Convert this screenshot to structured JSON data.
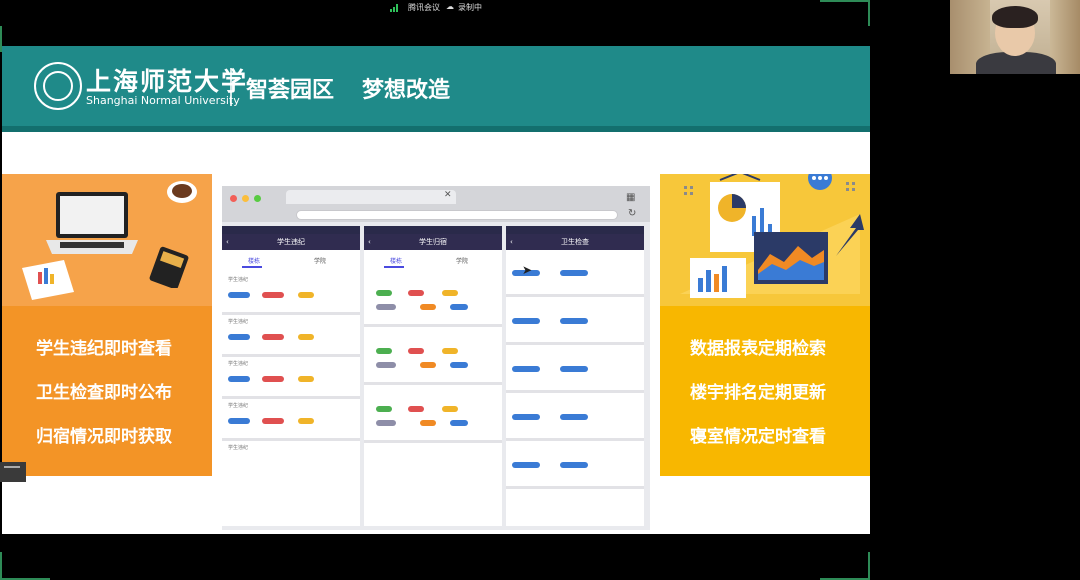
{
  "status_bar": {
    "app_name": "腾讯会议",
    "recording": "录制中"
  },
  "slide": {
    "university_cn": "上海师范大学",
    "university_en": "Shanghai Normal University",
    "slogan_1": "智荟园区",
    "slogan_2": "梦想改造",
    "left_features": [
      "学生违纪即时查看",
      "卫生检查即时公布",
      "归宿情况即时获取"
    ],
    "right_features": [
      "数据报表定期检索",
      "楼宇排名定期更新",
      "寝室情况定时查看"
    ]
  },
  "phones": [
    {
      "title": "学生违纪",
      "tab_1": "楼栋",
      "tab_2": "学院",
      "rows": [
        "学生违纪",
        "学生违纪",
        "学生违纪",
        "学生违纪",
        "学生违纪"
      ]
    },
    {
      "title": "学生归宿",
      "tab_1": "楼栋",
      "tab_2": "学院"
    },
    {
      "title": "卫生检查"
    }
  ],
  "colors": {
    "teal": "#1f8a89",
    "orange": "#f39426",
    "yellow": "#f8b700"
  }
}
